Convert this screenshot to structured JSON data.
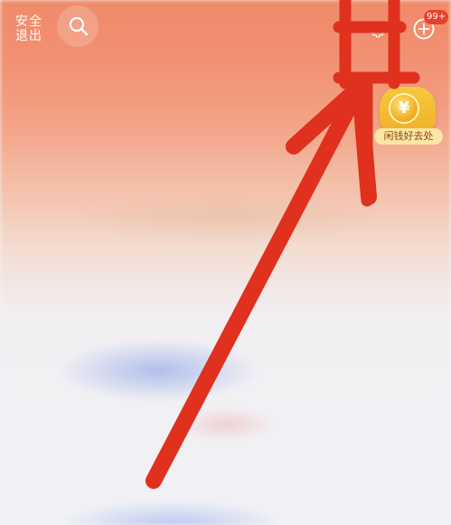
{
  "header": {
    "exit_line1": "安全",
    "exit_line2": "退出",
    "search_icon": "search-icon",
    "settings_icon": "gear-icon",
    "add_icon": "plus-circle-icon",
    "notification_badge": "99+"
  },
  "promo": {
    "coin_symbol": "¥",
    "label": "闲钱好去处"
  },
  "annotation": {
    "color": "#e0301e",
    "shapes": [
      "highlight-box",
      "pointer-arrow"
    ]
  }
}
